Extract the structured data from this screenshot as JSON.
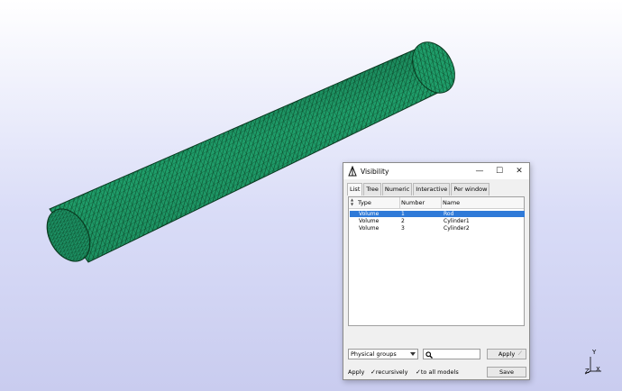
{
  "colors": {
    "mesh_fill": "#1f9e6a",
    "mesh_lines": "#0a3a20",
    "selection": "#2f7ad8"
  },
  "window": {
    "title": "Visibility",
    "controls": {
      "minimize": "—",
      "maximize": "☐",
      "close": "✕"
    },
    "tabs": [
      {
        "label": "List",
        "active": true
      },
      {
        "label": "Tree",
        "active": false
      },
      {
        "label": "Numeric",
        "active": false
      },
      {
        "label": "Interactive",
        "active": false
      },
      {
        "label": "Per window",
        "active": false
      }
    ],
    "columns": {
      "type": "Type",
      "number": "Number",
      "name": "Name"
    },
    "rows": [
      {
        "type": "Volume",
        "number": "1",
        "name": "Rod",
        "selected": true
      },
      {
        "type": "Volume",
        "number": "2",
        "name": "Cylinder1",
        "selected": false
      },
      {
        "type": "Volume",
        "number": "3",
        "name": "Cylinder2",
        "selected": false
      }
    ],
    "groups_select": "Physical groups",
    "search_placeholder": "",
    "apply_button": "Apply",
    "apply_label": "Apply",
    "recursively_label": "recursively",
    "to_all_models_label": "to all models",
    "save_button": "Save"
  },
  "axes": {
    "y": "Y",
    "x": "X",
    "z": "Z"
  }
}
